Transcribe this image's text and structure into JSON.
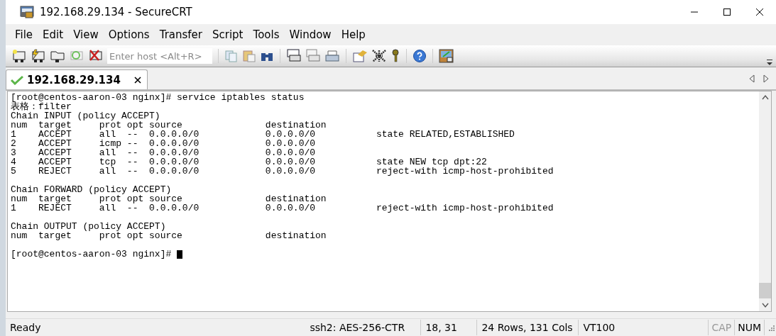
{
  "window": {
    "title": "192.168.29.134 - SecureCRT"
  },
  "menu": [
    "File",
    "Edit",
    "View",
    "Options",
    "Transfer",
    "Script",
    "Tools",
    "Window",
    "Help"
  ],
  "toolbar": {
    "host_field": {
      "placeholder": "Enter host <Alt+R>"
    }
  },
  "tabs": [
    {
      "label": "192.168.29.134",
      "selected": true,
      "connected": true
    }
  ],
  "terminal": {
    "blocks": [
      {
        "lines": [
          {
            "text": "[root@centos-aaron-03 nginx]# service iptables status",
            "cursor": false
          },
          {
            "text": "表格：filter",
            "cursor": false
          },
          {
            "text": "Chain INPUT (policy ACCEPT)",
            "cursor": false
          },
          {
            "text": "num  target     prot opt source               destination",
            "cursor": false
          },
          {
            "text": "1    ACCEPT     all  --  0.0.0.0/0            0.0.0.0/0           state RELATED,ESTABLISHED",
            "cursor": false
          },
          {
            "text": "2    ACCEPT     icmp --  0.0.0.0/0            0.0.0.0/0",
            "cursor": false
          },
          {
            "text": "3    ACCEPT     all  --  0.0.0.0/0            0.0.0.0/0",
            "cursor": false
          },
          {
            "text": "4    ACCEPT     tcp  --  0.0.0.0/0            0.0.0.0/0           state NEW tcp dpt:22",
            "cursor": false
          },
          {
            "text": "5    REJECT     all  --  0.0.0.0/0            0.0.0.0/0           reject-with icmp-host-prohibited",
            "cursor": false
          }
        ]
      },
      {
        "lines": [
          {
            "text": "Chain FORWARD (policy ACCEPT)",
            "cursor": false
          },
          {
            "text": "num  target     prot opt source               destination",
            "cursor": false
          },
          {
            "text": "1    REJECT     all  --  0.0.0.0/0            0.0.0.0/0           reject-with icmp-host-prohibited",
            "cursor": false
          }
        ]
      },
      {
        "lines": [
          {
            "text": "Chain OUTPUT (policy ACCEPT)",
            "cursor": false
          },
          {
            "text": "num  target     prot opt source               destination",
            "cursor": false
          }
        ]
      },
      {
        "lines": [
          {
            "text": "[root@centos-aaron-03 nginx]# ",
            "cursor": true
          }
        ]
      }
    ]
  },
  "status_bar": {
    "message": "Ready",
    "cipher": "ssh2: AES-256-CTR",
    "position": "18,  31",
    "size": "24 Rows, 131 Cols",
    "emulation": "VT100",
    "indicators": [
      {
        "label": "CAP",
        "enabled": false
      },
      {
        "label": "NUM",
        "enabled": true
      }
    ]
  }
}
